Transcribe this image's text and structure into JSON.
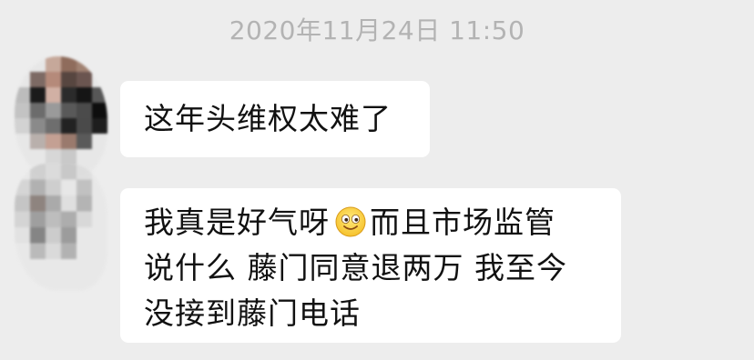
{
  "chat": {
    "timestamp": "2020年11月24日 11:50",
    "messages": [
      {
        "text": "这年头维权太难了"
      },
      {
        "line1_before_emoji": "我真是好气呀",
        "emoji": "smiling-face-icon",
        "line1_after_emoji": "而且市场监管",
        "line2": "说什么 藤门同意退两万 我至今",
        "line3": "没接到藤门电话"
      }
    ]
  },
  "colors": {
    "background": "#ededed",
    "bubble": "#ffffff",
    "timestamp_text": "#b3b3b3",
    "message_text": "#111111"
  }
}
